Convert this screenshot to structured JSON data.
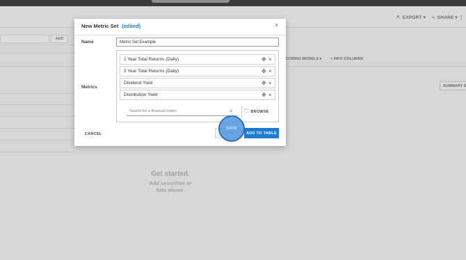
{
  "app": {
    "actions": [
      {
        "icon": "export-icon",
        "label": "EXPORT"
      },
      {
        "icon": "share-icon",
        "label": "SHARE"
      }
    ],
    "add_label": "ADD",
    "tabs": [
      "CORING MODELS",
      "INFO COLUMNS"
    ],
    "summary_label": "SUMMARY S",
    "empty_state": {
      "heading": "Get started.",
      "line1": "Add securities or",
      "line2": "lists above."
    }
  },
  "modal": {
    "title": "New Metric Set",
    "status": "(edited)",
    "name_label": "Name",
    "name_value": "Metric Set Example",
    "metrics_label": "Metrics",
    "metrics": [
      {
        "label": "1 Year Total Returns (Daily)"
      },
      {
        "label": "3 Year Total Returns (Daily)"
      },
      {
        "label": "Dividend Yield"
      },
      {
        "label": "Distribution Yield"
      }
    ],
    "search_placeholder": "Search for a financial metric",
    "browse_label": "BROWSE",
    "cancel_label": "CANCEL",
    "save_label": "SAVE",
    "add_to_table_label": "ADD TO TABLE"
  },
  "colors": {
    "accent": "#1e7ad2",
    "edited": "#2279c9",
    "click_highlight": "#4a92de"
  }
}
